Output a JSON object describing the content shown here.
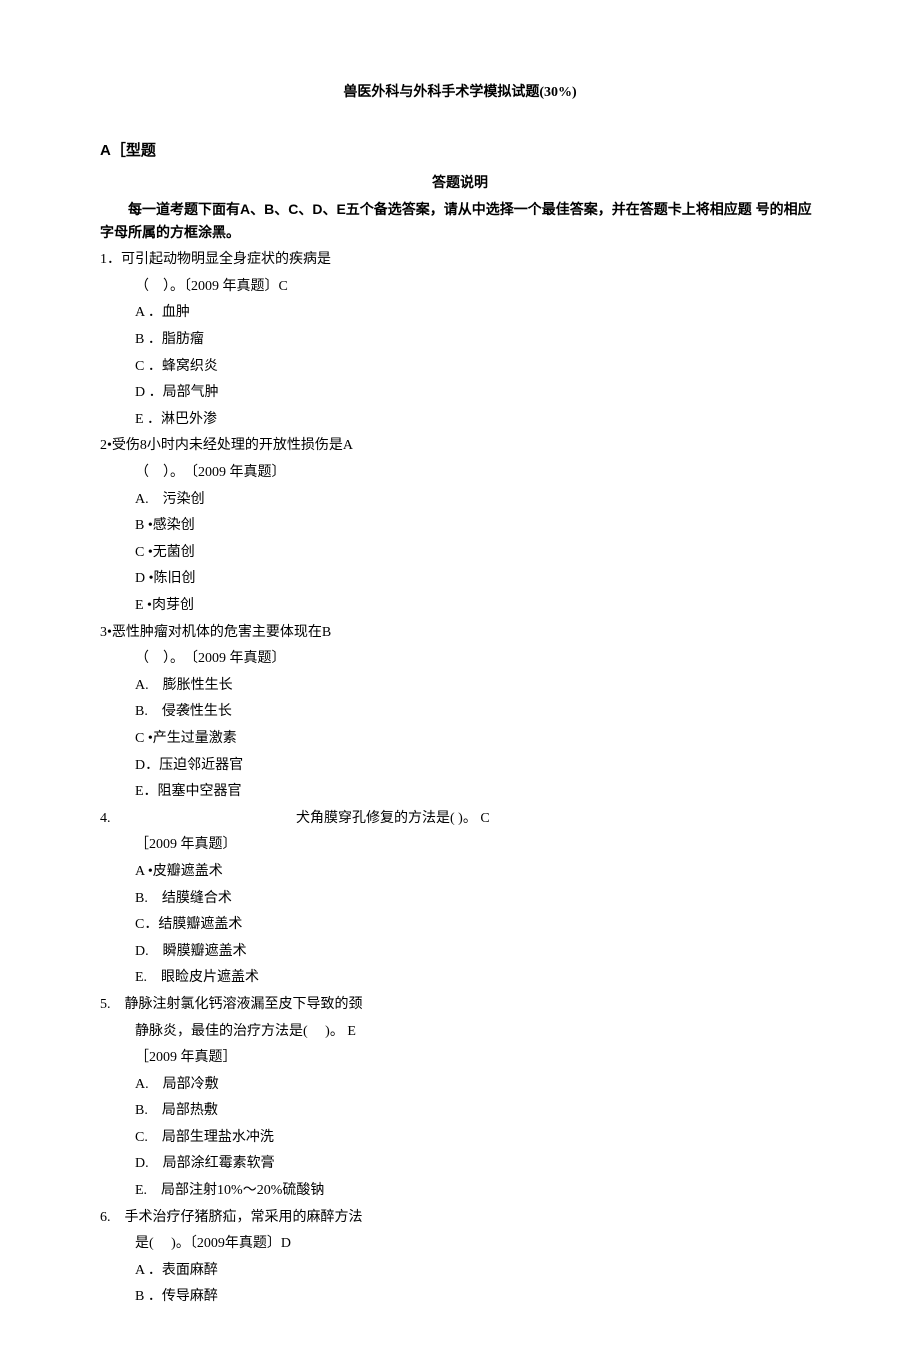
{
  "title": "兽医外科与外科手术学模拟试题(30%)",
  "section": "A［型题",
  "instructions_header": "答题说明",
  "instructions": "每一道考题下面有A、B、C、D、E五个备选答案，请从中选择一个最佳答案，并在答题卡上将相应题 号的相应字母所属的方框涂黑。",
  "questions": [
    {
      "num": "1",
      "stem": "可引起动物明显全身症状的疾病是",
      "blank": "（　）。",
      "source": "〔2009 年真题〕",
      "answer": "C",
      "options": [
        "A ．血肿",
        "B ．脂肪瘤",
        "C ．蜂窝织炎",
        "D ．局部气肿",
        "E ．淋巴外渗"
      ]
    },
    {
      "num": "2",
      "stem": "•受伤8小时内未经处理的开放性损伤是A",
      "blank": "（　）。",
      "source": "〔2009 年真题〕",
      "options": [
        "A.　污染创",
        "B •感染创",
        "C •无菌创",
        "D •陈旧创",
        "E •肉芽创"
      ]
    },
    {
      "num": "3",
      "stem": "•恶性肿瘤对机体的危害主要体现在B",
      "blank": "（　）。",
      "source": "〔2009 年真题〕",
      "options": [
        "A.　膨胀性生长",
        "B.　侵袭性生长",
        "C •产生过量激素",
        "D．压迫邻近器官",
        "E．阻塞中空器官"
      ]
    },
    {
      "num": "4",
      "stem": "犬角膜穿孔修复的方法是( )。 C",
      "source": "［2009 年真题〕",
      "options": [
        "A •皮瓣遮盖术",
        "B.　结膜缝合术",
        "C．结膜瓣遮盖术",
        "D.　瞬膜瓣遮盖术",
        "E.　眼睑皮片遮盖术"
      ]
    },
    {
      "num": "5",
      "stem": "静脉注射氯化钙溶液漏至皮下导致的颈",
      "sub": "静脉炎，最佳的治疗方法是(　 )。 E",
      "source": "［2009 年真题］",
      "options": [
        "A.　局部冷敷",
        "B.　局部热敷",
        "C.　局部生理盐水冲洗",
        "D.　局部涂红霉素软膏",
        "E.　局部注射10%〜20%硫酸钠"
      ]
    },
    {
      "num": "6",
      "stem": "手术治疗仔猪脐疝，常采用的麻醉方法",
      "sub": "是(　 )。〔2009年真题〕D",
      "options": [
        "A ．表面麻醉",
        "B ．传导麻醉"
      ]
    }
  ]
}
